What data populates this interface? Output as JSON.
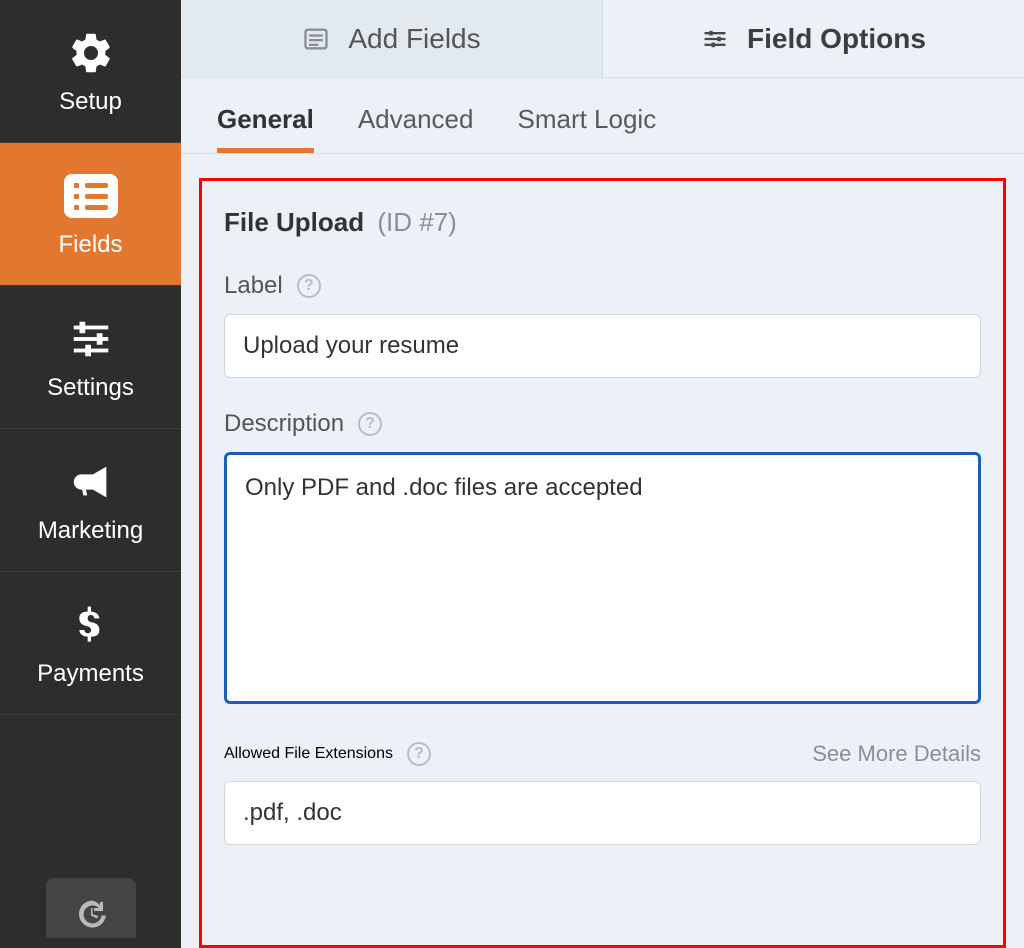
{
  "sidebar": {
    "items": [
      {
        "label": "Setup"
      },
      {
        "label": "Fields"
      },
      {
        "label": "Settings"
      },
      {
        "label": "Marketing"
      },
      {
        "label": "Payments"
      }
    ]
  },
  "toptabs": {
    "add_fields": "Add Fields",
    "field_options": "Field Options"
  },
  "subtabs": {
    "general": "General",
    "advanced": "Advanced",
    "smart_logic": "Smart Logic"
  },
  "section": {
    "title": "File Upload",
    "id_tag": "(ID #7)"
  },
  "form": {
    "label_label": "Label",
    "label_value": "Upload your resume",
    "description_label": "Description",
    "description_value": "Only PDF and .doc files are accepted",
    "extensions_label": "Allowed File Extensions",
    "extensions_value": ".pdf, .doc",
    "see_more": "See More Details"
  },
  "icons": {
    "help": "?"
  }
}
